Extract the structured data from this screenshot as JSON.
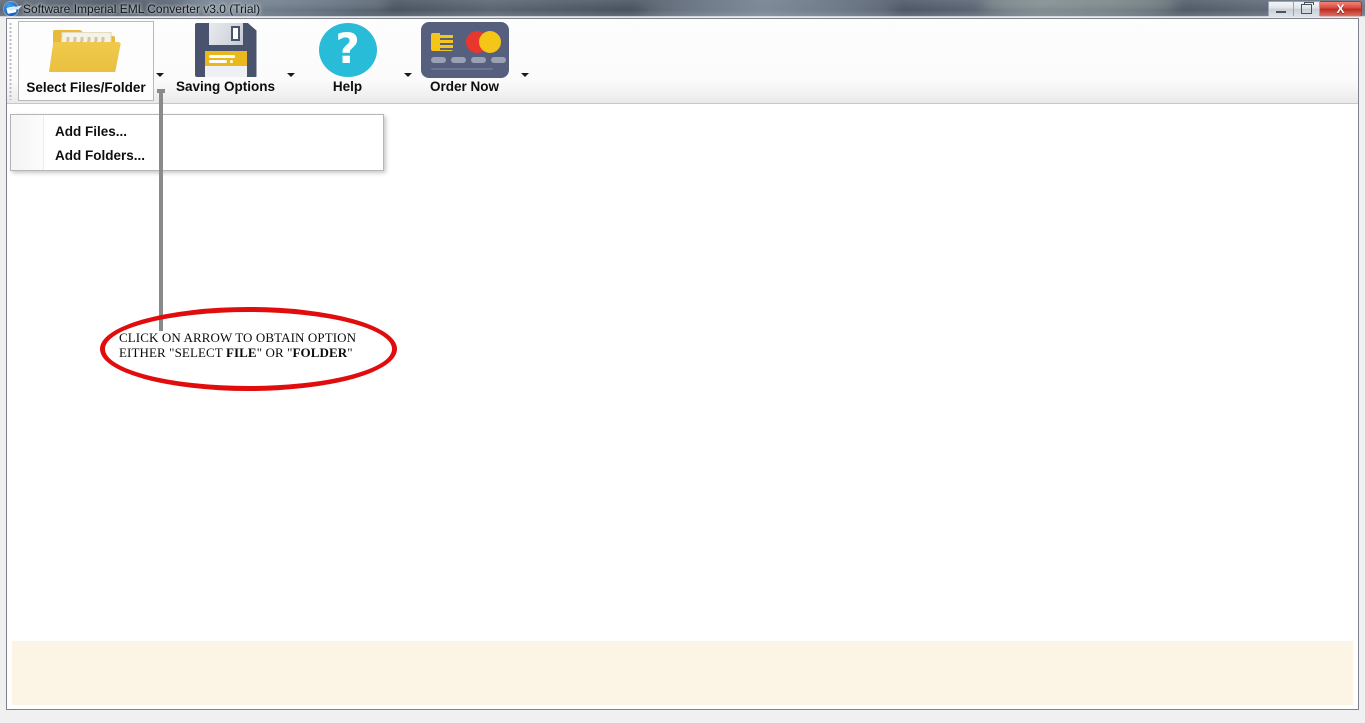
{
  "window": {
    "title": "Software Imperial EML Converter v3.0 (Trial)",
    "app_icon": "envelope-icon",
    "controls": {
      "minimize": "minimize-icon",
      "maximize": "maximize-icon",
      "close": "X"
    }
  },
  "ribbon": {
    "tools": [
      {
        "id": "select-files-folder",
        "label": "Select Files/Folder",
        "icon": "folder-open-icon",
        "has_dropdown": true,
        "active": true
      },
      {
        "id": "saving-options",
        "label": "Saving Options",
        "icon": "floppy-disk-icon",
        "has_dropdown": true,
        "active": false
      },
      {
        "id": "help",
        "label": "Help",
        "icon": "question-mark-icon",
        "has_dropdown": true,
        "active": false
      },
      {
        "id": "order-now",
        "label": "Order Now",
        "icon": "credit-card-icon",
        "has_dropdown": true,
        "active": false
      }
    ]
  },
  "dropdown": {
    "items": [
      {
        "label": "Add Files..."
      },
      {
        "label": "Add Folders..."
      }
    ]
  },
  "annotation": {
    "line1": "CLICK ON ARROW TO OBTAIN OPTION",
    "line2_part1": "EITHER \"SELECT ",
    "line2_bold1": "FILE",
    "line2_part2": "\" OR \"",
    "line2_bold2": "FOLDER",
    "line2_part3": "\"",
    "ellipse_color": "#e10d0d",
    "pointer_color": "#8a8a8a"
  },
  "colors": {
    "titlebar": "#4a5462",
    "folder": "#eac03f",
    "floppy": "#49536e",
    "help": "#29bcd8",
    "card": "#565f7d",
    "bottom_panel": "#fcf4e4",
    "close_button": "#d9463a"
  }
}
